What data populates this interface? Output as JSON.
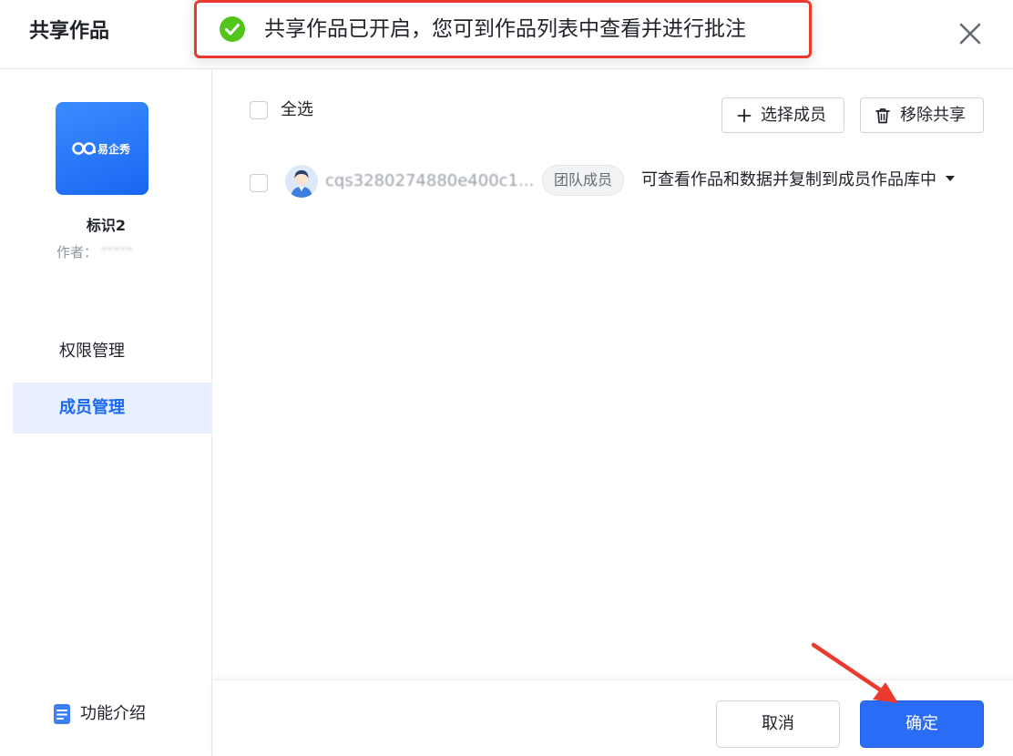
{
  "dialog": {
    "title": "共享作品",
    "close_icon": "close-icon"
  },
  "toast": {
    "icon": "check-circle-icon",
    "message": "共享作品已开启，您可到作品列表中查看并进行批注",
    "icon_color": "#52c41a",
    "border_color": "#ea3a2e"
  },
  "sidebar": {
    "cover_brand": "易企秀",
    "work_title": "标识2",
    "author_label": "作者：",
    "author_name": "\"\"\"\"\"",
    "nav": [
      {
        "label": "权限管理",
        "active": false
      },
      {
        "label": "成员管理",
        "active": true
      }
    ],
    "feature_intro_label": "功能介绍",
    "feature_intro_icon": "document-icon"
  },
  "toolbar": {
    "select_all_label": "全选",
    "select_members_label": "选择成员",
    "select_members_icon": "plus-icon",
    "remove_share_label": "移除共享",
    "remove_share_icon": "trash-icon"
  },
  "members": [
    {
      "name": "cqs3280274880e400c1...",
      "tag": "团队成员",
      "permission": "可查看作品和数据并复制到成员作品库中",
      "avatar_icon": "user-avatar-icon"
    }
  ],
  "footer": {
    "cancel_label": "取消",
    "confirm_label": "确定"
  },
  "colors": {
    "primary": "#2b6cf6",
    "active_nav_bg": "#e8efff",
    "annotation_red": "#ea3a2e"
  }
}
